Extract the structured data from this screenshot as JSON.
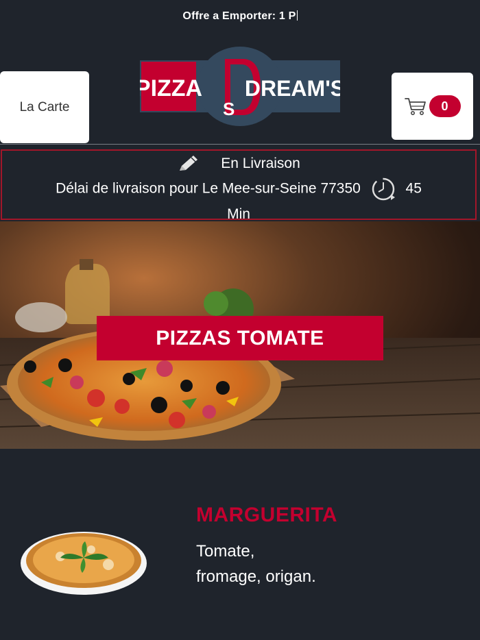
{
  "promo": {
    "text": "Offre a Emporter: 1 P"
  },
  "header": {
    "menu_label": "La Carte",
    "logo": {
      "left_text": "PIZZA",
      "right_text": "DREAM'S",
      "monogram": "DS"
    },
    "cart": {
      "icon": "cart-icon",
      "count": "0"
    }
  },
  "delivery": {
    "mode_icon": "pencil-icon",
    "mode": "En Livraison",
    "delay_text": "Délai de livraison pour Le Mee-sur-Seine 77350",
    "clock_icon": "clock-icon",
    "delay_value": "45",
    "delay_unit": "Min"
  },
  "hero": {
    "title": "PIZZAS TOMATE"
  },
  "products": [
    {
      "name": "MARGUERITA",
      "description_line1": "Tomate,",
      "description_line2": "fromage, origan."
    }
  ],
  "colors": {
    "background": "#1f242c",
    "accent": "#c3002f",
    "border": "#a3162a"
  }
}
